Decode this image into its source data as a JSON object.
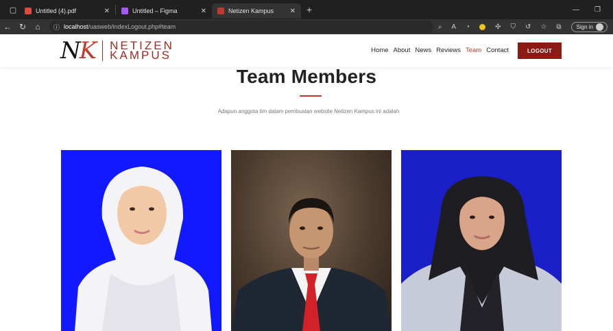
{
  "browser": {
    "tabs": [
      {
        "title": "Untitled (4).pdf",
        "favicon_color": "#e04a3c"
      },
      {
        "title": "Untitled – Figma",
        "favicon_color": "#a259ff"
      },
      {
        "title": "Netizen Kampus",
        "favicon_color": "#c0392b"
      }
    ],
    "url_host": "localhost",
    "url_path": "/uasweb/indexLogout.php#team",
    "signin_label": "Sign in"
  },
  "site": {
    "logo_mark_n": "N",
    "logo_mark_k": "K",
    "logo_line1": "NETIZEN",
    "logo_line2": "KAMPUS",
    "nav": [
      {
        "label": "Home"
      },
      {
        "label": "About"
      },
      {
        "label": "News"
      },
      {
        "label": "Reviews"
      },
      {
        "label": "Team",
        "active": true
      },
      {
        "label": "Contact"
      }
    ],
    "logout_label": "LOGOUT",
    "accent_color": "#8b1a14"
  },
  "team": {
    "title": "Team Members",
    "description": "Adapun anggota tim dalam pembuatan website Netizen Kampus ini adalah",
    "members": [
      {
        "photo": "woman-white-hijab-blue-background"
      },
      {
        "photo": "man-suit-red-tie-brown-background"
      },
      {
        "photo": "woman-black-hijab-blue-background"
      }
    ]
  }
}
